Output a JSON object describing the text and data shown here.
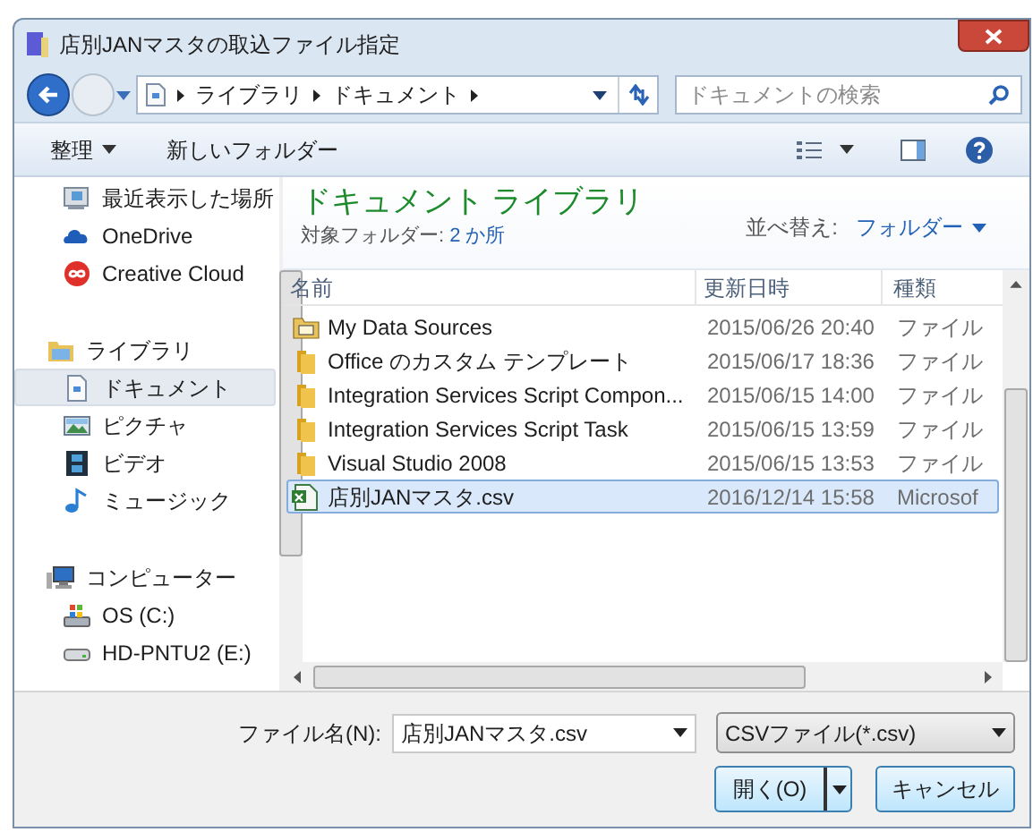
{
  "window": {
    "title": "店別JANマスタの取込ファイル指定"
  },
  "address": {
    "segments": [
      "ライブラリ",
      "ドキュメント"
    ],
    "search_placeholder": "ドキュメントの検索"
  },
  "toolbar": {
    "organize": "整理",
    "new_folder": "新しいフォルダー"
  },
  "navigation": [
    {
      "children": [
        {
          "kind": "recent",
          "label": "最近表示した場所",
          "selected": false
        },
        {
          "kind": "onedrive",
          "label": "OneDrive",
          "selected": false
        },
        {
          "kind": "cloud",
          "label": "Creative Cloud",
          "selected": false
        }
      ]
    },
    {
      "kind": "library",
      "label": "ライブラリ",
      "selected": false,
      "children": [
        {
          "kind": "documents",
          "label": "ドキュメント",
          "selected": true
        },
        {
          "kind": "pictures",
          "label": "ピクチャ",
          "selected": false
        },
        {
          "kind": "video",
          "label": "ビデオ",
          "selected": false
        },
        {
          "kind": "music",
          "label": "ミュージック",
          "selected": false
        }
      ]
    },
    {
      "kind": "computer",
      "label": "コンピューター",
      "selected": false,
      "children": [
        {
          "kind": "os_drive",
          "label": "OS (C:)",
          "selected": false
        },
        {
          "kind": "drive",
          "label": "HD-PNTU2 (E:)",
          "selected": false
        }
      ]
    }
  ],
  "library_header": {
    "title": "ドキュメント ライブラリ",
    "folders_label": "対象フォルダー:",
    "folders_link": "2 か所",
    "sort_label": "並べ替え:",
    "sort_value": "フォルダー"
  },
  "table": {
    "columns": [
      "名前",
      "更新日時",
      "種類"
    ],
    "rows": [
      {
        "kind": "data_folder",
        "name": "My Data Sources",
        "modified": "2015/06/26 20:40",
        "type": "ファイル",
        "selected": false
      },
      {
        "kind": "folder",
        "name": "Office のカスタム テンプレート",
        "modified": "2015/06/17 18:36",
        "type": "ファイル",
        "selected": false
      },
      {
        "kind": "folder",
        "name": "Integration Services Script Compon...",
        "modified": "2015/06/15 14:00",
        "type": "ファイル",
        "selected": false
      },
      {
        "kind": "folder",
        "name": "Integration Services Script Task",
        "modified": "2015/06/15 13:59",
        "type": "ファイル",
        "selected": false
      },
      {
        "kind": "folder",
        "name": "Visual Studio 2008",
        "modified": "2015/06/15 13:53",
        "type": "ファイル",
        "selected": false
      },
      {
        "kind": "csv",
        "name": "店別JANマスタ.csv",
        "modified": "2016/12/14 15:58",
        "type": "Microsof",
        "selected": true
      }
    ]
  },
  "file_name": {
    "label": "ファイル名(N):",
    "value": "店別JANマスタ.csv"
  },
  "file_type": {
    "value": "CSVファイル(*.csv)"
  },
  "buttons": {
    "open": "開く(O)",
    "cancel": "キャンセル"
  }
}
